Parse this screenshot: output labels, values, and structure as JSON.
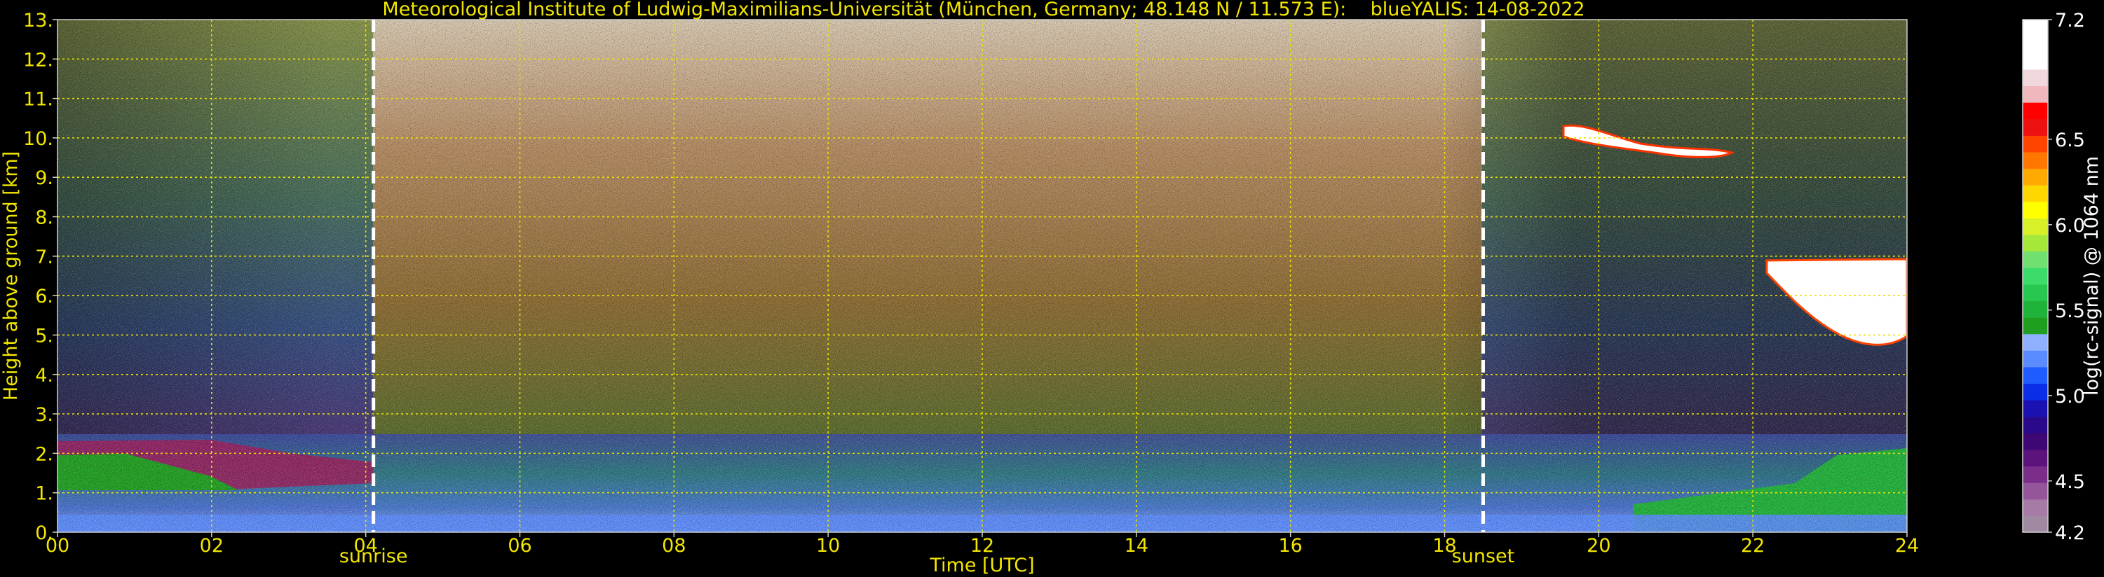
{
  "chart_data": {
    "type": "heatmap",
    "title": "Meteorological Institute of Ludwig-Maximilians-Universität (München, Germany; 48.148 N / 11.573 E):    blueYALIS: 14-08-2022",
    "xlabel": "Time [UTC]",
    "ylabel": "Height above ground [km]",
    "xlim": [
      0,
      24
    ],
    "ylim": [
      0,
      13
    ],
    "x_ticks": [
      "00",
      "02",
      "04",
      "06",
      "08",
      "10",
      "12",
      "14",
      "16",
      "18",
      "20",
      "22",
      "24"
    ],
    "x_tick_values": [
      0,
      2,
      4,
      6,
      8,
      10,
      12,
      14,
      16,
      18,
      20,
      22,
      24
    ],
    "y_ticks": [
      "0.",
      "1.",
      "2.",
      "3.",
      "4.",
      "5.",
      "6.",
      "7.",
      "8.",
      "9.",
      "10.",
      "11.",
      "12.",
      "13."
    ],
    "y_tick_values": [
      0,
      1,
      2,
      3,
      4,
      5,
      6,
      7,
      8,
      9,
      10,
      11,
      12,
      13
    ],
    "grid": true,
    "annotations": [
      {
        "label": "sunrise",
        "time_utc": 4.1
      },
      {
        "label": "sunset",
        "time_utc": 18.5
      }
    ],
    "colorbar": {
      "label": "log(rc-signal) @ 1064 nm",
      "range": [
        4.2,
        7.2
      ],
      "tick_labels": [
        "4.2",
        "4.5",
        "5.0",
        "5.5",
        "6.0",
        "6.5",
        "7.2"
      ],
      "tick_values": [
        4.2,
        4.5,
        5.0,
        5.5,
        6.0,
        6.5,
        7.2
      ],
      "colors": [
        "#a08aa2",
        "#a67ca6",
        "#94559a",
        "#7a2e8a",
        "#5c137c",
        "#3d0873",
        "#2a0a8a",
        "#1b11b3",
        "#0a2ee8",
        "#1f5cff",
        "#5b8cff",
        "#8fb0ff",
        "#1f9e1f",
        "#20b33a",
        "#28c850",
        "#3ddc6a",
        "#70e070",
        "#a6e83a",
        "#d8f028",
        "#ffff00",
        "#ffd700",
        "#ffaa00",
        "#ff7700",
        "#ff4400",
        "#ee1111",
        "#ff0000",
        "#f0b8bc",
        "#f0d8dc",
        "#ffffff",
        "#ffffff",
        "#ffffff"
      ]
    }
  }
}
